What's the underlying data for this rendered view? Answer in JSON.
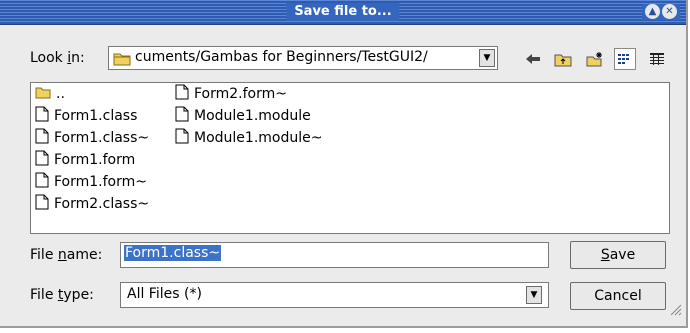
{
  "titlebar": {
    "title": "Save file to..."
  },
  "lookin": {
    "label_pre": "Look ",
    "label_u": "i",
    "label_post": "n:",
    "path": "cuments/Gambas for Beginners/TestGUI2/"
  },
  "files": {
    "col1": [
      "..",
      "Form1.class",
      "Form1.class~",
      "Form1.form",
      "Form1.form~",
      "Form2.class~"
    ],
    "col2": [
      "Form2.form~",
      "Module1.module",
      "Module1.module~"
    ]
  },
  "filename": {
    "label_pre": "File ",
    "label_u": "n",
    "label_post": "ame:",
    "value": "Form1.class~"
  },
  "filetype": {
    "label_pre": "File ",
    "label_u": "t",
    "label_post": "ype:",
    "value": "All Files (*)"
  },
  "buttons": {
    "save_u": "S",
    "save_rest": "ave",
    "cancel": "Cancel"
  },
  "colors": {
    "titlebar": "#3d6bbf",
    "selection": "#3c72c8",
    "folder": "#f0d060"
  },
  "icons": [
    "close-icon",
    "minimize-icon",
    "folder-icon",
    "back-arrow-icon",
    "up-folder-icon",
    "new-folder-icon",
    "list-view-icon",
    "detail-view-icon",
    "file-icon",
    "resize-grip-icon"
  ]
}
